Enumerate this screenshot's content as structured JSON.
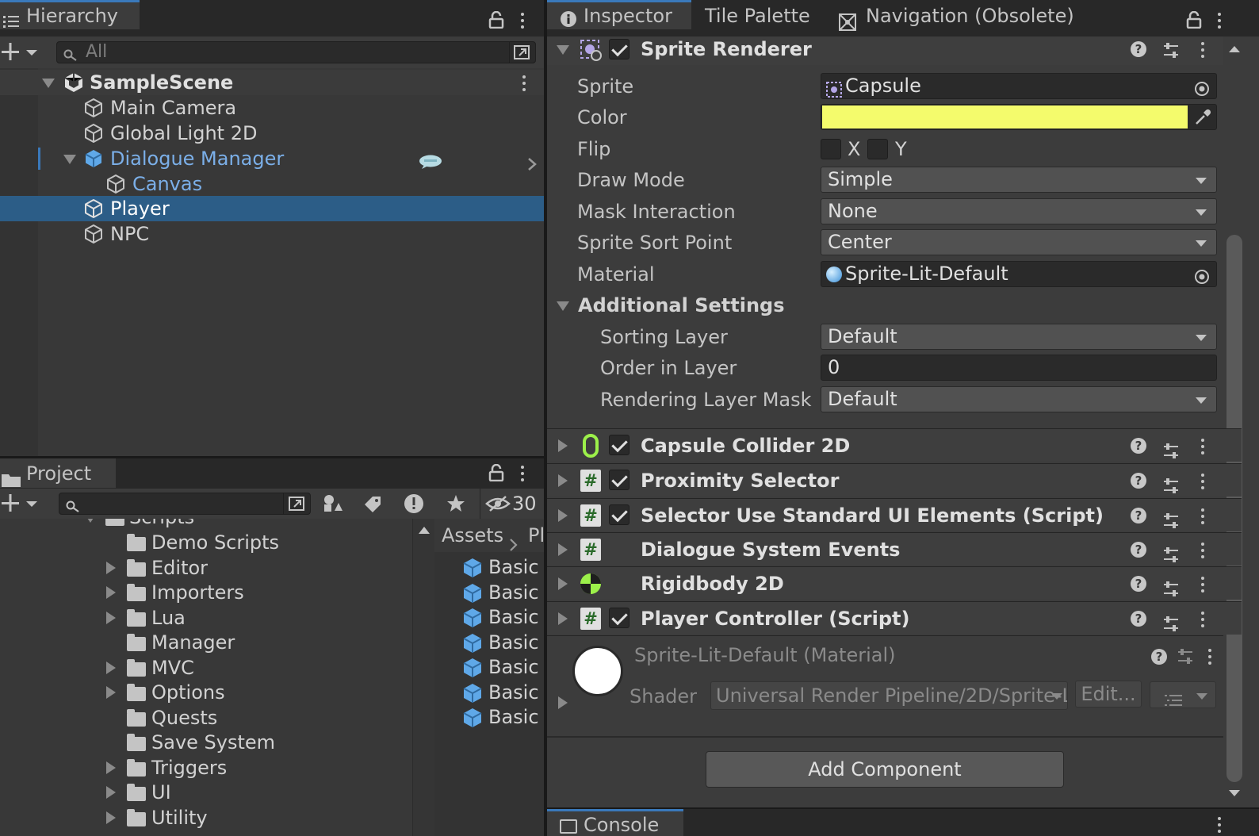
{
  "hierarchy": {
    "tab_label": "Hierarchy",
    "search_placeholder": "All",
    "scene_name": "SampleScene",
    "items": [
      "Main Camera",
      "Global Light 2D",
      "Dialogue Manager",
      "Canvas",
      "Player",
      "NPC"
    ]
  },
  "project": {
    "tab_label": "Project",
    "hidden_count": "30",
    "folders": [
      "Scripts",
      "Demo Scripts",
      "Editor",
      "Importers",
      "Lua",
      "Manager",
      "MVC",
      "Options",
      "Quests",
      "Save System",
      "Triggers",
      "UI",
      "Utility"
    ],
    "breadcrumb_root": "Assets",
    "breadcrumb_next": "Pl",
    "assets": [
      "Basic",
      "Basic",
      "Basic",
      "Basic",
      "Basic",
      "Basic",
      "Basic"
    ]
  },
  "inspector": {
    "tabs": [
      "Inspector",
      "Tile Palette",
      "Navigation (Obsolete)"
    ],
    "sprite_renderer": {
      "title": "Sprite Renderer",
      "sprite_label": "Sprite",
      "sprite_value": "Capsule",
      "color_label": "Color",
      "color_value": "#f4fb6c",
      "flip_label": "Flip",
      "flip_x": "X",
      "flip_y": "Y",
      "draw_mode_label": "Draw Mode",
      "draw_mode_value": "Simple",
      "mask_label": "Mask Interaction",
      "mask_value": "None",
      "sort_point_label": "Sprite Sort Point",
      "sort_point_value": "Center",
      "material_label": "Material",
      "material_value": "Sprite-Lit-Default",
      "additional_label": "Additional Settings",
      "sorting_layer_label": "Sorting Layer",
      "sorting_layer_value": "Default",
      "order_label": "Order in Layer",
      "order_value": "0",
      "rendering_mask_label": "Rendering Layer Mask",
      "rendering_mask_value": "Default"
    },
    "components": [
      "Capsule Collider 2D",
      "Proximity Selector",
      "Selector Use Standard UI Elements (Script)",
      "Dialogue System Events",
      "Rigidbody 2D",
      "Player Controller (Script)"
    ],
    "material": {
      "title": "Sprite-Lit-Default (Material)",
      "shader_label": "Shader",
      "shader_value": "Universal Render Pipeline/2D/Sprite-L",
      "edit_label": "Edit..."
    },
    "add_component_label": "Add Component",
    "console_label": "Console"
  },
  "colors": {
    "selection": "#2c5d87",
    "accent_blue": "#7bafe8"
  }
}
